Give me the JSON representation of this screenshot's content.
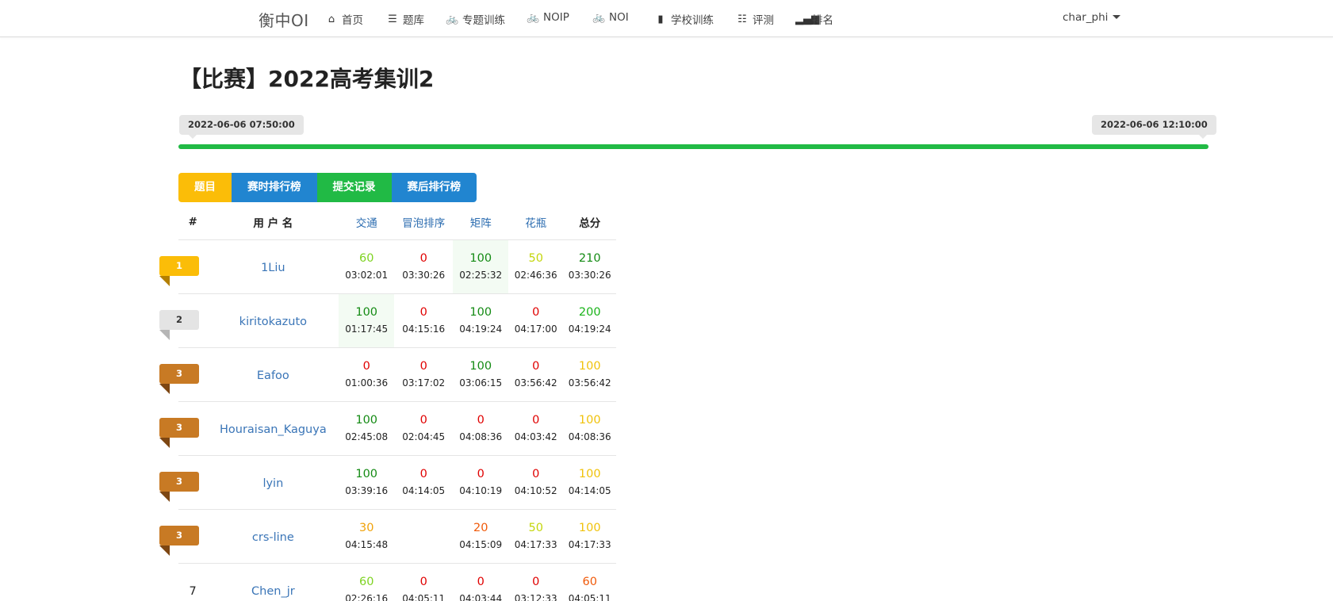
{
  "nav": {
    "brand": "衡中OI",
    "items": [
      {
        "label": "首页",
        "icon": "home-icon",
        "glyph": "⌂"
      },
      {
        "label": "题库",
        "icon": "list-icon",
        "glyph": "☰"
      },
      {
        "label": "专题训练",
        "icon": "bicycle-icon",
        "glyph": "🚲"
      },
      {
        "label": "NOIP",
        "icon": "bicycle-icon",
        "glyph": "🚲"
      },
      {
        "label": "NOI",
        "icon": "bicycle-icon",
        "glyph": "🚲"
      },
      {
        "label": "学校训练",
        "icon": "building-icon",
        "glyph": "▮"
      },
      {
        "label": "评测",
        "icon": "tasks-icon",
        "glyph": "☷"
      },
      {
        "label": "排名",
        "icon": "signal-icon",
        "glyph": "▂▄▆"
      }
    ],
    "user": "char_phi"
  },
  "contest": {
    "title": "【比赛】2022高考集训2",
    "start_time": "2022-06-06 07:50:00",
    "end_time": "2022-06-06 12:10:00",
    "progress_percent": 100,
    "progress_color": "#21ba45"
  },
  "tabs": [
    {
      "label": "题目",
      "color": "#fbbd08"
    },
    {
      "label": "赛时排行榜",
      "color": "#2185d0"
    },
    {
      "label": "提交记录",
      "color": "#21ba45"
    },
    {
      "label": "赛后排行榜",
      "color": "#2185d0"
    }
  ],
  "table": {
    "headers": {
      "rank": "#",
      "username": "用 户 名",
      "total": "总分"
    },
    "problems": [
      "交通",
      "冒泡排序",
      "矩阵",
      "花瓶"
    ],
    "rows": [
      {
        "rank": "1",
        "medal": "gold",
        "user": "1Liu",
        "cells": [
          {
            "score": "60",
            "time": "03:02:01"
          },
          {
            "score": "0",
            "time": "03:30:26"
          },
          {
            "score": "100",
            "time": "02:25:32",
            "first": true
          },
          {
            "score": "50",
            "time": "02:46:36"
          }
        ],
        "total": {
          "score": "210",
          "time": "03:30:26"
        }
      },
      {
        "rank": "2",
        "medal": "silver",
        "user": "kiritokazuto",
        "cells": [
          {
            "score": "100",
            "time": "01:17:45",
            "first": true
          },
          {
            "score": "0",
            "time": "04:15:16"
          },
          {
            "score": "100",
            "time": "04:19:24"
          },
          {
            "score": "0",
            "time": "04:17:00"
          }
        ],
        "total": {
          "score": "200",
          "time": "04:19:24"
        }
      },
      {
        "rank": "3",
        "medal": "bronze",
        "user": "Eafoo",
        "cells": [
          {
            "score": "0",
            "time": "01:00:36"
          },
          {
            "score": "0",
            "time": "03:17:02"
          },
          {
            "score": "100",
            "time": "03:06:15"
          },
          {
            "score": "0",
            "time": "03:56:42"
          }
        ],
        "total": {
          "score": "100",
          "time": "03:56:42"
        }
      },
      {
        "rank": "3",
        "medal": "bronze",
        "user": "Houraisan_Kaguya",
        "cells": [
          {
            "score": "100",
            "time": "02:45:08"
          },
          {
            "score": "0",
            "time": "02:04:45"
          },
          {
            "score": "0",
            "time": "04:08:36"
          },
          {
            "score": "0",
            "time": "04:03:42"
          }
        ],
        "total": {
          "score": "100",
          "time": "04:08:36"
        }
      },
      {
        "rank": "3",
        "medal": "bronze",
        "user": "lyin",
        "cells": [
          {
            "score": "100",
            "time": "03:39:16"
          },
          {
            "score": "0",
            "time": "04:14:05"
          },
          {
            "score": "0",
            "time": "04:10:19"
          },
          {
            "score": "0",
            "time": "04:10:52"
          }
        ],
        "total": {
          "score": "100",
          "time": "04:14:05"
        }
      },
      {
        "rank": "3",
        "medal": "bronze",
        "user": "crs-line",
        "cells": [
          {
            "score": "30",
            "time": "04:15:48"
          },
          {
            "score": "",
            "time": ""
          },
          {
            "score": "20",
            "time": "04:15:09"
          },
          {
            "score": "50",
            "time": "04:17:33"
          }
        ],
        "total": {
          "score": "100",
          "time": "04:17:33"
        }
      },
      {
        "rank": "7",
        "medal": "",
        "user": "Chen_jr",
        "cells": [
          {
            "score": "60",
            "time": "02:26:16"
          },
          {
            "score": "0",
            "time": "04:05:11"
          },
          {
            "score": "0",
            "time": "04:03:44"
          },
          {
            "score": "0",
            "time": "03:12:33"
          }
        ],
        "total": {
          "score": "60",
          "time": "04:05:11"
        }
      }
    ]
  }
}
